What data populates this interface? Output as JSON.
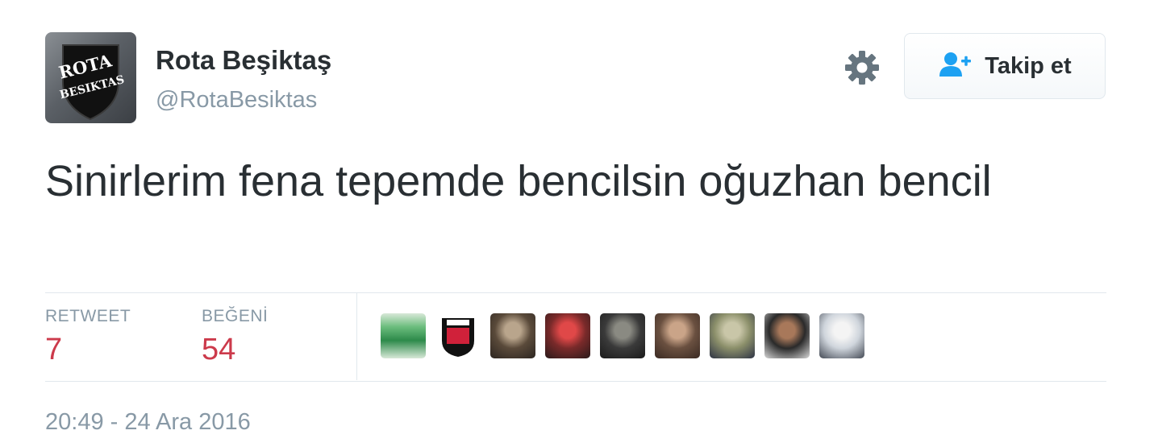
{
  "user": {
    "display_name": "Rota Beşiktaş",
    "handle": "@RotaBesiktas",
    "avatar_text": [
      "ROTA",
      "BESIKTAS"
    ]
  },
  "follow_button": {
    "label": "Takip et",
    "icon": "add-user-icon"
  },
  "settings_icon": "gear-icon",
  "tweet": {
    "text": "Sinirlerim fena tepemde bencilsin oğuzhan bencil"
  },
  "stats": {
    "retweet_label": "RETWEET",
    "retweet_count": "7",
    "like_label": "BEĞENİ",
    "like_count": "54"
  },
  "likers": [
    {
      "name": "liker-avatar-1",
      "colors": [
        "#2d8a4a",
        "#6bbd7d",
        "#d8e8d8"
      ]
    },
    {
      "name": "liker-avatar-2",
      "colors": [
        "#ffffff",
        "#111111",
        "#d0213a"
      ]
    },
    {
      "name": "liker-avatar-3",
      "colors": [
        "#5a4a3a",
        "#b9a58c",
        "#2c2520"
      ]
    },
    {
      "name": "liker-avatar-4",
      "colors": [
        "#7a2a2a",
        "#e04848",
        "#2a1a1a"
      ]
    },
    {
      "name": "liker-avatar-5",
      "colors": [
        "#3a3a3a",
        "#8a8a82",
        "#1a1a1a"
      ]
    },
    {
      "name": "liker-avatar-6",
      "colors": [
        "#6a5040",
        "#caa488",
        "#3a2a22"
      ]
    },
    {
      "name": "liker-avatar-7",
      "colors": [
        "#8b8f6a",
        "#c9c6a8",
        "#2d3344"
      ]
    },
    {
      "name": "liker-avatar-8",
      "colors": [
        "#2a2a2a",
        "#a8785a",
        "#d8d8d8"
      ]
    },
    {
      "name": "liker-avatar-9",
      "colors": [
        "#cfd5dc",
        "#f4f4f4",
        "#444a55"
      ]
    }
  ],
  "timestamp": "20:49 - 24 Ara 2016",
  "colors": {
    "text": "#292f33",
    "muted": "#8899a6",
    "stat_value": "#cc3a4b",
    "follow_icon": "#1da1f2",
    "divider": "#e1e8ed"
  }
}
